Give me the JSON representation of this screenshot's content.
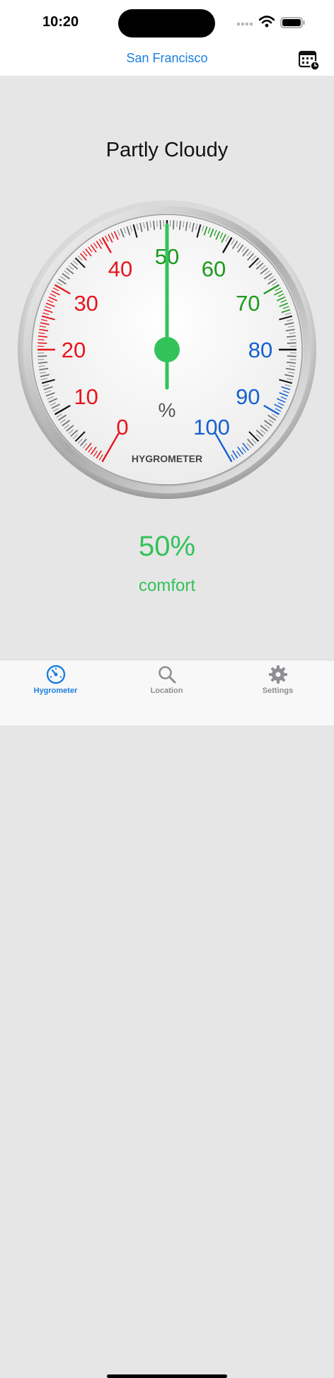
{
  "status_bar": {
    "time": "10:20"
  },
  "nav": {
    "title": "San Francisco",
    "calendar_icon": "calendar-clock-icon"
  },
  "condition": "Partly Cloudy",
  "gauge": {
    "label": "HYGROMETER",
    "unit": "%",
    "value": 50,
    "tick_labels": [
      {
        "text": "0",
        "value": 0,
        "color": "#e8141c"
      },
      {
        "text": "10",
        "value": 10,
        "color": "#e8141c"
      },
      {
        "text": "20",
        "value": 20,
        "color": "#e8141c"
      },
      {
        "text": "30",
        "value": 30,
        "color": "#e8141c"
      },
      {
        "text": "40",
        "value": 40,
        "color": "#e8141c"
      },
      {
        "text": "50",
        "value": 50,
        "color": "#1a9a1a"
      },
      {
        "text": "60",
        "value": 60,
        "color": "#1a9a1a"
      },
      {
        "text": "70",
        "value": 70,
        "color": "#1a9a1a"
      },
      {
        "text": "80",
        "value": 80,
        "color": "#1560d0"
      },
      {
        "text": "90",
        "value": 90,
        "color": "#1560d0"
      },
      {
        "text": "100",
        "value": 100,
        "color": "#1560d0"
      }
    ],
    "needle_color": "#33c25a"
  },
  "reading": {
    "value_text": "50%",
    "status": "comfort",
    "color": "#33c25a"
  },
  "tabs": [
    {
      "label": "Hygrometer",
      "icon": "gauge-icon",
      "active": true
    },
    {
      "label": "Location",
      "icon": "search-icon",
      "active": false
    },
    {
      "label": "Settings",
      "icon": "gear-icon",
      "active": false
    }
  ],
  "colors": {
    "accent": "#1a7fe0",
    "inactive": "#8e8e93",
    "comfort": "#33c25a"
  }
}
